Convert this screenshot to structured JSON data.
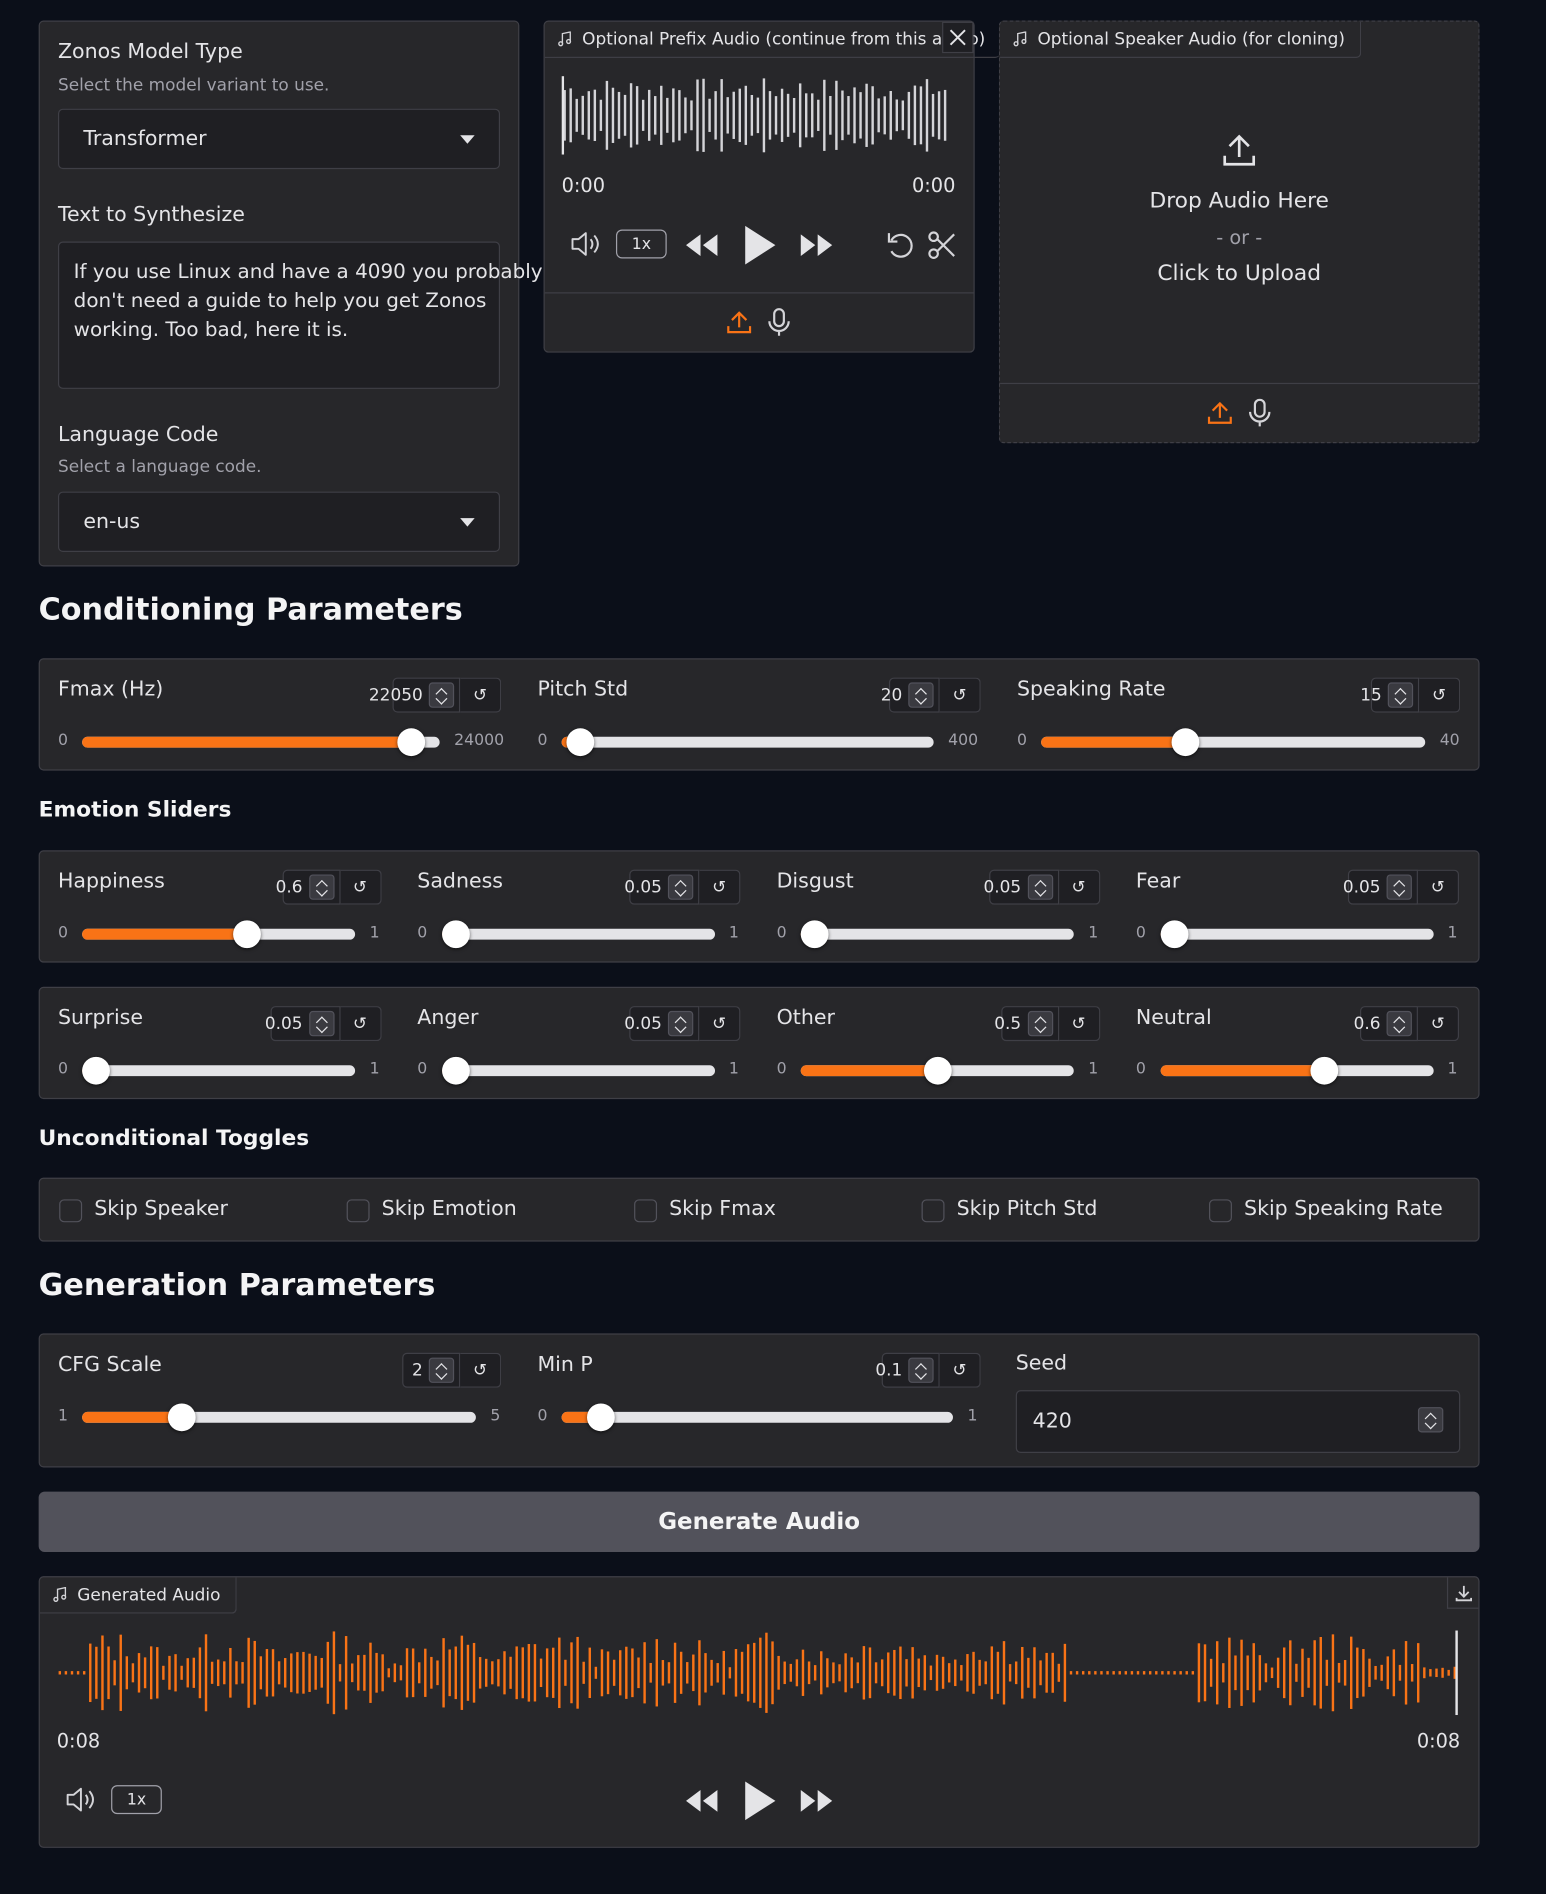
{
  "model": {
    "label": "Zonos Model Type",
    "info": "Select the model variant to use.",
    "value": "Transformer"
  },
  "text": {
    "label": "Text to Synthesize",
    "lines": [
      "If you use Linux and have a 4090 you probably",
      "don't need a guide to help you get Zonos",
      "working. Too bad, here it is."
    ]
  },
  "language": {
    "label": "Language Code",
    "info": "Select a language code.",
    "value": "en-us"
  },
  "prefix_audio": {
    "label": "Optional Prefix Audio (continue from this audio)",
    "time_current": "0:00",
    "time_total": "0:00",
    "rate": "1x"
  },
  "speaker_audio": {
    "label": "Optional Speaker Audio (for cloning)",
    "drop": "Drop Audio Here",
    "or": "- or -",
    "click": "Click to Upload"
  },
  "sections": {
    "conditioning": "Conditioning Parameters",
    "emotion": "Emotion Sliders",
    "toggles": "Unconditional Toggles",
    "generation": "Generation Parameters"
  },
  "reset_glyph": "↺",
  "conditioning": [
    {
      "label": "Fmax (Hz)",
      "value": "22050",
      "min": "0",
      "max": "24000",
      "fraction": 0.91875
    },
    {
      "label": "Pitch Std",
      "value": "20",
      "min": "0",
      "max": "400",
      "fraction": 0.05
    },
    {
      "label": "Speaking Rate",
      "value": "15",
      "min": "0",
      "max": "40",
      "fraction": 0.375
    }
  ],
  "emotions_row1": [
    {
      "label": "Happiness",
      "value": "0.6",
      "min": "0",
      "max": "1",
      "fraction": 0.6
    },
    {
      "label": "Sadness",
      "value": "0.05",
      "min": "0",
      "max": "1",
      "fraction": 0.05
    },
    {
      "label": "Disgust",
      "value": "0.05",
      "min": "0",
      "max": "1",
      "fraction": 0.05
    },
    {
      "label": "Fear",
      "value": "0.05",
      "min": "0",
      "max": "1",
      "fraction": 0.05
    }
  ],
  "emotions_row2": [
    {
      "label": "Surprise",
      "value": "0.05",
      "min": "0",
      "max": "1",
      "fraction": 0.05
    },
    {
      "label": "Anger",
      "value": "0.05",
      "min": "0",
      "max": "1",
      "fraction": 0.05
    },
    {
      "label": "Other",
      "value": "0.5",
      "min": "0",
      "max": "1",
      "fraction": 0.5
    },
    {
      "label": "Neutral",
      "value": "0.6",
      "min": "0",
      "max": "1",
      "fraction": 0.6
    }
  ],
  "toggles": [
    "Skip Speaker",
    "Skip Emotion",
    "Skip Fmax",
    "Skip Pitch Std",
    "Skip Speaking Rate"
  ],
  "generation": {
    "cfg": {
      "label": "CFG Scale",
      "value": "2",
      "min": "1",
      "max": "5",
      "fraction": 0.25
    },
    "minp": {
      "label": "Min P",
      "value": "0.1",
      "min": "0",
      "max": "1",
      "fraction": 0.1
    },
    "seed": {
      "label": "Seed",
      "value": "420"
    }
  },
  "generate_button": "Generate Audio",
  "generated_audio": {
    "label": "Generated Audio",
    "time_current": "0:08",
    "time_total": "0:08",
    "rate": "1x"
  },
  "colors": {
    "accent": "#f97316",
    "background": "#0b0f19",
    "panel": "#27272a"
  },
  "icons": [
    "music-note-icon",
    "close-icon",
    "volume-icon",
    "rewind-icon",
    "play-icon",
    "forward-icon",
    "undo-icon",
    "scissors-icon",
    "upload-icon",
    "microphone-icon",
    "download-icon"
  ]
}
